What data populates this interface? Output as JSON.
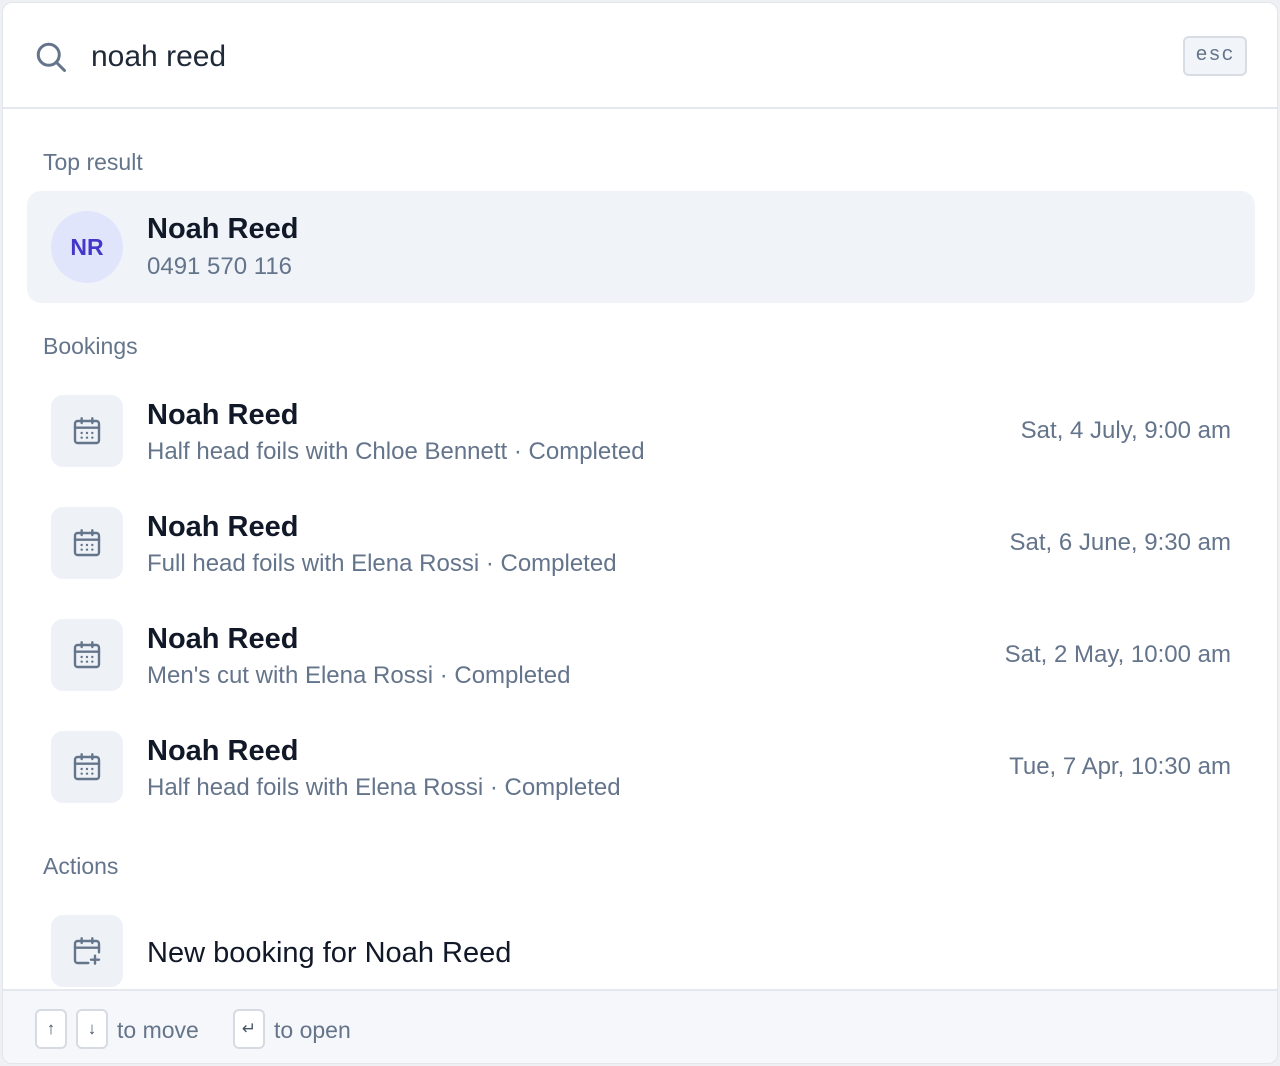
{
  "search": {
    "value": "noah reed",
    "esc_label": "esc"
  },
  "sections": {
    "top_result": "Top result",
    "bookings": "Bookings",
    "actions": "Actions"
  },
  "top_result": {
    "initials": "NR",
    "name": "Noah Reed",
    "phone": "0491 570 116"
  },
  "bookings": [
    {
      "name": "Noah Reed",
      "detail": "Half head foils with Chloe Bennett · Completed",
      "datetime": "Sat, 4 July, 9:00 am"
    },
    {
      "name": "Noah Reed",
      "detail": "Full head foils with Elena Rossi · Completed",
      "datetime": "Sat, 6 June, 9:30 am"
    },
    {
      "name": "Noah Reed",
      "detail": "Men's cut with Elena Rossi · Completed",
      "datetime": "Sat, 2 May, 10:00 am"
    },
    {
      "name": "Noah Reed",
      "detail": "Half head foils with Elena Rossi · Completed",
      "datetime": "Tue, 7 Apr, 10:30 am"
    }
  ],
  "actions": [
    {
      "label": "New booking for Noah Reed",
      "icon": "calendar-plus-icon"
    }
  ],
  "footer": {
    "up_key": "↑",
    "down_key": "↓",
    "move_hint": "to move",
    "enter_key": "↵",
    "open_hint": "to open"
  },
  "colors": {
    "accent": "#4338ca",
    "avatar_bg": "#e1e5fc",
    "active_row_bg": "#f0f3f8",
    "muted_text": "#64748b"
  }
}
